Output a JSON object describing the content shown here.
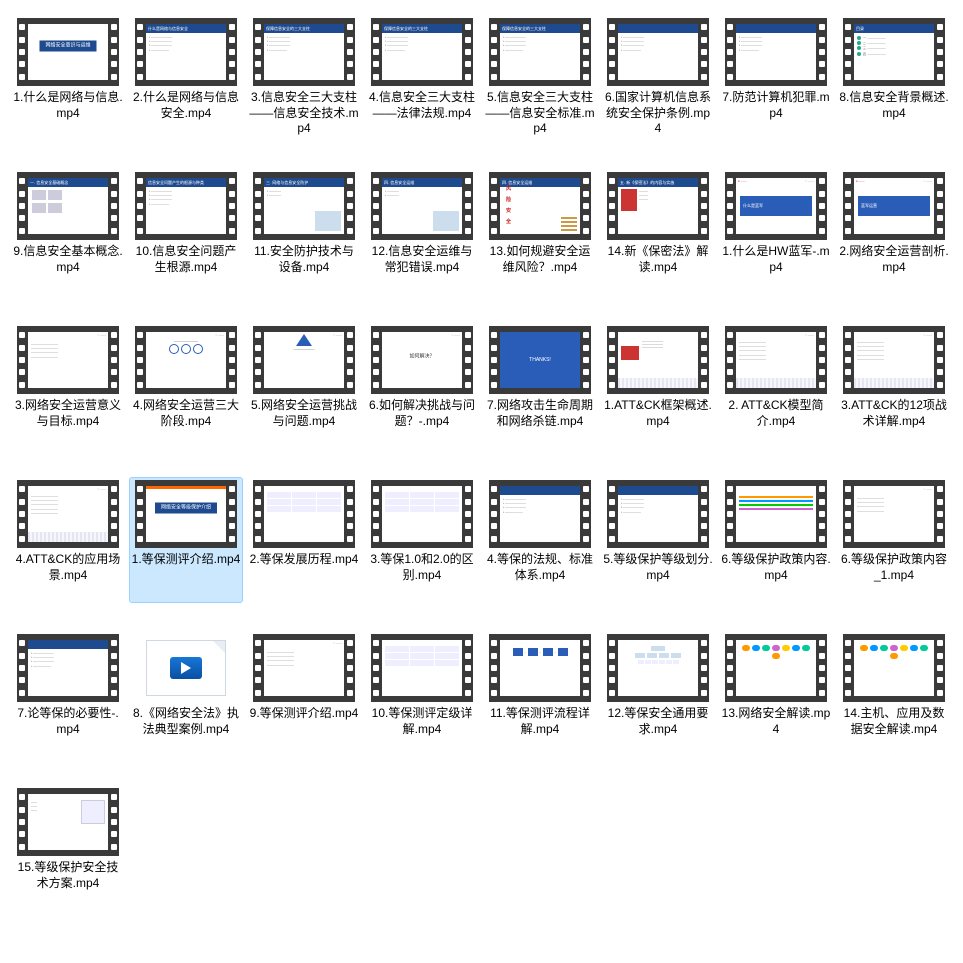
{
  "items": [
    {
      "name": "1.什么是网络与信息.mp4",
      "thumbType": "centerTitle",
      "thumbText": "网络安全意识与运维"
    },
    {
      "name": "2.什么是网络与信息安全.mp4",
      "thumbType": "bulletSlide",
      "thumbTitle": "什么是网络与信息安全"
    },
    {
      "name": "3.信息安全三大支柱——信息安全技术.mp4",
      "thumbType": "bulletSlide",
      "thumbTitle": "保障信息安全的三大支柱"
    },
    {
      "name": "4.信息安全三大支柱——法律法规.mp4",
      "thumbType": "bulletSlide",
      "thumbTitle": "保障信息安全的三大支柱"
    },
    {
      "name": "5.信息安全三大支柱——信息安全标准.mp4",
      "thumbType": "bulletSlide",
      "thumbTitle": "保障信息安全的三大支柱"
    },
    {
      "name": "6.国家计算机信息系统安全保护条例.mp4",
      "thumbType": "bulletSlide",
      "thumbTitle": ""
    },
    {
      "name": "7.防范计算机犯罪.mp4",
      "thumbType": "bulletSlide",
      "thumbTitle": ""
    },
    {
      "name": "8.信息安全背景概述.mp4",
      "thumbType": "checklist",
      "thumbTitle": "目录"
    },
    {
      "name": "9.信息安全基本概念.mp4",
      "thumbType": "imageGrid",
      "thumbTitle": "一. 信息安全基础概念"
    },
    {
      "name": "10.信息安全问题产生根源.mp4",
      "thumbType": "bulletSlide",
      "thumbTitle": "信息安全问题产生的根源与种类"
    },
    {
      "name": "11.安全防护技术与设备.mp4",
      "thumbType": "imageSlide",
      "thumbTitle": "三. 网络与信息安全防护"
    },
    {
      "name": "12.信息安全运维与常犯错误.mp4",
      "thumbType": "imageSlide",
      "thumbTitle": "四. 信息安全运维"
    },
    {
      "name": "13.如何规避安全运维风险？.mp4",
      "thumbType": "redVertical",
      "thumbTitle": "四. 信息安全运维"
    },
    {
      "name": "14.新《保密法》解读.mp4",
      "thumbType": "bookSlide",
      "thumbTitle": "五. 新《保密法》的内容与实施"
    },
    {
      "name": "1.什么是HW蓝军-.mp4",
      "thumbType": "blueCard",
      "thumbText": "什么是蓝军"
    },
    {
      "name": "2.网络安全运营剖析.mp4",
      "thumbType": "blueCard",
      "thumbText": "蓝军运营"
    },
    {
      "name": "3.网络安全运营意义与目标.mp4",
      "thumbType": "textSlide"
    },
    {
      "name": "4.网络安全运营三大阶段.mp4",
      "thumbType": "circles"
    },
    {
      "name": "5.网络安全运营挑战与问题.mp4",
      "thumbType": "triangle"
    },
    {
      "name": "6.如何解决挑战与问题？-.mp4",
      "thumbType": "whiteCard",
      "thumbText": "如何解决？"
    },
    {
      "name": "7.网络攻击生命周期和网络杀链.mp4",
      "thumbType": "fullBlue",
      "thumbText": "THANKS!"
    },
    {
      "name": "1.ATT&CK框架概述.mp4",
      "thumbType": "attck",
      "thumbText": ""
    },
    {
      "name": "2.  ATT&CK模型简介.mp4",
      "thumbType": "denseText"
    },
    {
      "name": "3.ATT&CK的12项战术详解.mp4",
      "thumbType": "denseText"
    },
    {
      "name": "4.ATT&CK的应用场景.mp4",
      "thumbType": "denseText"
    },
    {
      "name": "1.等保测评介绍.mp4",
      "thumbType": "centerTitleOrange",
      "thumbText": "网络安全等级保护介绍",
      "selected": true
    },
    {
      "name": "2.等保发展历程.mp4",
      "thumbType": "tableSlide"
    },
    {
      "name": "3.等保1.0和2.0的区别.mp4",
      "thumbType": "tableSlide"
    },
    {
      "name": "4.等保的法规、标准体系.mp4",
      "thumbType": "bulletSlide"
    },
    {
      "name": "5.等级保护等级划分.mp4",
      "thumbType": "bulletSlide"
    },
    {
      "name": "6.等级保护政策内容.mp4",
      "thumbType": "barSlide"
    },
    {
      "name": "6.等级保护政策内容_1.mp4",
      "thumbType": "textSlide"
    },
    {
      "name": "7.论等保的必要性-.mp4",
      "thumbType": "bulletSlide"
    },
    {
      "name": "8.《网络安全法》执法典型案例.mp4",
      "thumbType": "wmv"
    },
    {
      "name": "9.等保测评介绍.mp4",
      "thumbType": "textSlide"
    },
    {
      "name": "10.等保测评定级详解.mp4",
      "thumbType": "tableSlide"
    },
    {
      "name": "11.等保测评流程详解.mp4",
      "thumbType": "flowSlide"
    },
    {
      "name": "12.等保安全通用要求.mp4",
      "thumbType": "orgChart"
    },
    {
      "name": "13.网络安全解读.mp4",
      "thumbType": "cloudSlide"
    },
    {
      "name": "14.主机、应用及数据安全解读.mp4",
      "thumbType": "cloudSlide"
    },
    {
      "name": "15.等级保护安全技术方案.mp4",
      "thumbType": "diagSlide"
    }
  ]
}
